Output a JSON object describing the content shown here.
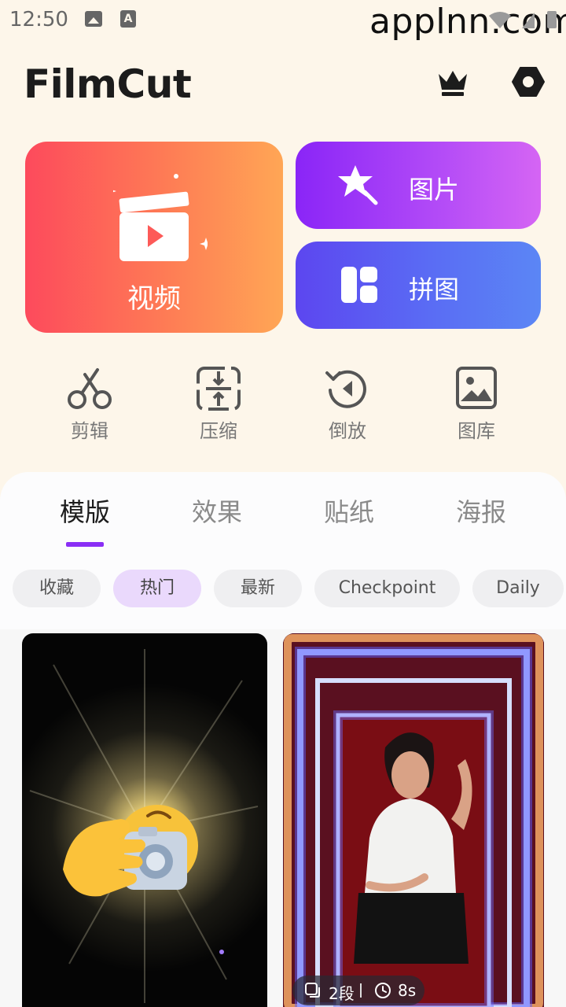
{
  "status_bar": {
    "time": "12:50",
    "watermark": "applnn.com"
  },
  "header": {
    "app_title": "FilmCut"
  },
  "main_actions": {
    "video_label": "视频",
    "photo_label": "图片",
    "collage_label": "拼图"
  },
  "tools": [
    {
      "label": "剪辑",
      "icon": "scissors-icon"
    },
    {
      "label": "压缩",
      "icon": "compress-icon"
    },
    {
      "label": "倒放",
      "icon": "reverse-icon"
    },
    {
      "label": "图库",
      "icon": "gallery-icon"
    }
  ],
  "tabs": [
    {
      "label": "模版",
      "active": true
    },
    {
      "label": "效果",
      "active": false
    },
    {
      "label": "贴纸",
      "active": false
    },
    {
      "label": "海报",
      "active": false
    }
  ],
  "chips": [
    {
      "label": "收藏",
      "active": false
    },
    {
      "label": "热门",
      "active": true
    },
    {
      "label": "最新",
      "active": false
    },
    {
      "label": "Checkpoint",
      "active": false
    },
    {
      "label": "Daily",
      "active": false
    }
  ],
  "templates": [
    {
      "name": "emoji-camera-flash"
    },
    {
      "name": "neon-frame-portrait",
      "segments": "2段",
      "duration": "8s"
    }
  ],
  "colors": {
    "background": "#fdf6ea",
    "accent": "#8a2ef5",
    "video_gradient": [
      "#fd4a5c",
      "#ffa655"
    ],
    "photo_gradient": [
      "#8a25f7",
      "#d565f4"
    ],
    "collage_gradient": [
      "#5c46f0",
      "#5b86f5"
    ]
  }
}
